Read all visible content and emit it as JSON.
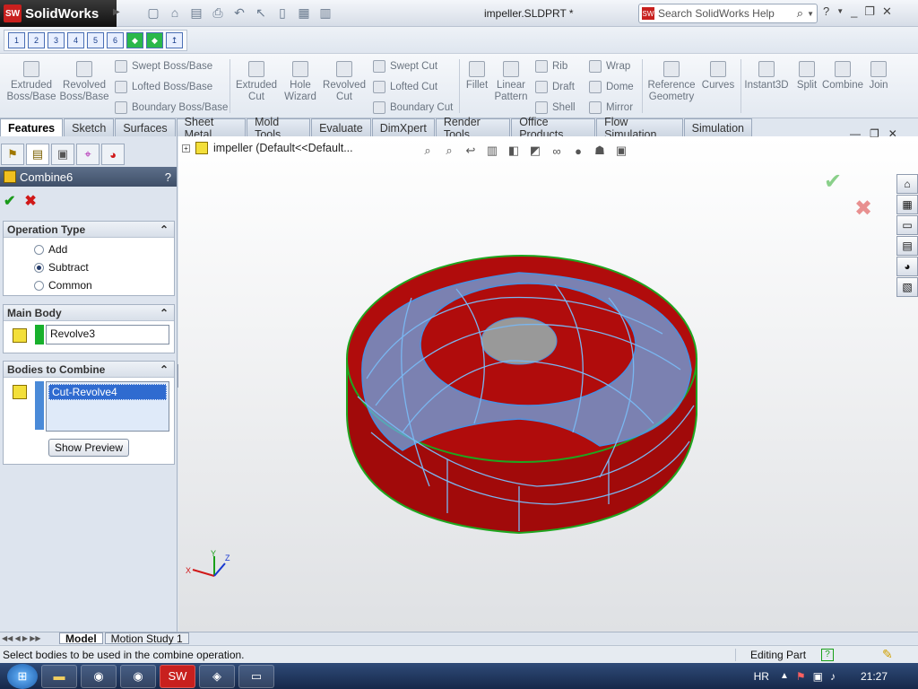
{
  "app": {
    "name": "SolidWorks",
    "document_title": "impeller.SLDPRT *"
  },
  "search": {
    "placeholder": "Search SolidWorks Help"
  },
  "command_manager": {
    "big_buttons": [
      {
        "label": "Extruded Boss/Base"
      },
      {
        "label": "Revolved Boss/Base"
      },
      {
        "label": "Extruded Cut"
      },
      {
        "label": "Hole Wizard"
      },
      {
        "label": "Revolved Cut"
      },
      {
        "label": "Fillet"
      },
      {
        "label": "Linear Pattern"
      },
      {
        "label": "Reference Geometry"
      },
      {
        "label": "Curves"
      },
      {
        "label": "Instant3D"
      },
      {
        "label": "Split"
      },
      {
        "label": "Combine"
      },
      {
        "label": "Join"
      }
    ],
    "small_buttons": [
      {
        "label": "Swept Boss/Base"
      },
      {
        "label": "Lofted Boss/Base"
      },
      {
        "label": "Boundary Boss/Base"
      },
      {
        "label": "Swept Cut"
      },
      {
        "label": "Lofted Cut"
      },
      {
        "label": "Boundary Cut"
      },
      {
        "label": "Rib"
      },
      {
        "label": "Draft"
      },
      {
        "label": "Shell"
      },
      {
        "label": "Wrap"
      },
      {
        "label": "Dome"
      },
      {
        "label": "Mirror"
      }
    ]
  },
  "tabs": [
    {
      "label": "Features",
      "active": true
    },
    {
      "label": "Sketch"
    },
    {
      "label": "Surfaces"
    },
    {
      "label": "Sheet Metal"
    },
    {
      "label": "Mold Tools"
    },
    {
      "label": "Evaluate"
    },
    {
      "label": "DimXpert"
    },
    {
      "label": "Render Tools"
    },
    {
      "label": "Office Products"
    },
    {
      "label": "Flow Simulation"
    },
    {
      "label": "Simulation"
    }
  ],
  "property_manager": {
    "title": "Combine6",
    "help": "?",
    "operation_type": {
      "title": "Operation Type",
      "options": [
        "Add",
        "Subtract",
        "Common"
      ],
      "selected": "Subtract"
    },
    "main_body": {
      "title": "Main Body",
      "value": "Revolve3"
    },
    "bodies_to_combine": {
      "title": "Bodies to Combine",
      "items": [
        "Cut-Revolve4"
      ],
      "preview_button": "Show Preview"
    }
  },
  "viewport": {
    "tree_label": "impeller  (Default<<Default...",
    "triad": {
      "x": "X",
      "y": "Y",
      "z": "Z"
    }
  },
  "bottom_tabs": [
    {
      "label": "Model",
      "active": true
    },
    {
      "label": "Motion Study 1"
    }
  ],
  "status": {
    "message": "Select bodies to be used in the combine operation.",
    "mode": "Editing Part"
  },
  "taskbar": {
    "language": "HR",
    "clock": "21:27"
  },
  "colors": {
    "part_red": "#b00c0c",
    "cut_blue": "#6aa8e8",
    "edge_green": "#1fa61f",
    "accent_blue": "#2f6bd0"
  }
}
